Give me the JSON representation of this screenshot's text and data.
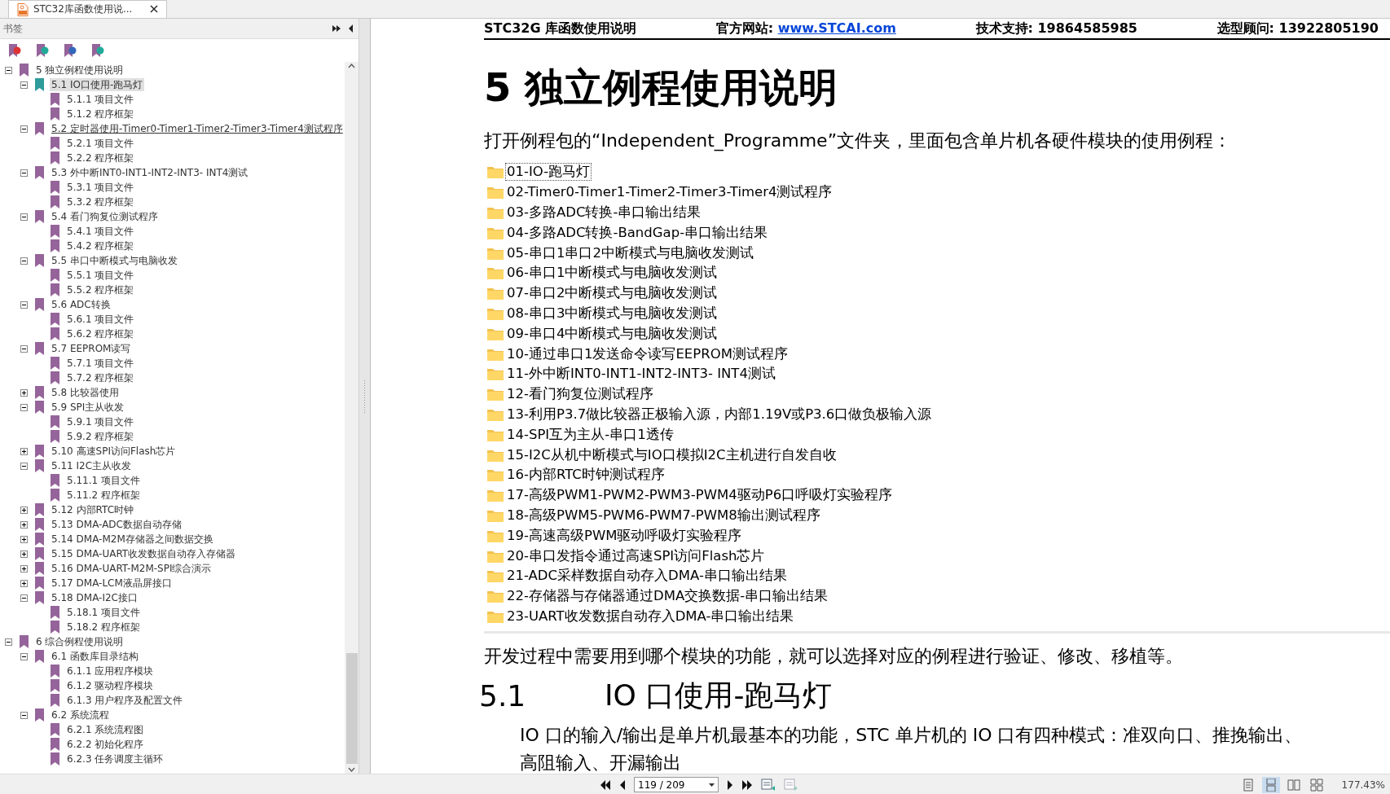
{
  "tab": {
    "title": "STC32库函数使用说..."
  },
  "bookmarks_panel": {
    "title": "书签",
    "tree": [
      {
        "label": "5 独立例程使用说明",
        "expanded": true,
        "selected": false,
        "hovered": false,
        "children": [
          {
            "label": "5.1 IO口使用-跑马灯",
            "expanded": true,
            "selected": true,
            "hovered": false,
            "children": [
              {
                "label": "5.1.1 项目文件",
                "selected": false,
                "hovered": false
              },
              {
                "label": "5.1.2 程序框架",
                "selected": false,
                "hovered": false
              }
            ]
          },
          {
            "label": "5.2 定时器使用-Timer0-Timer1-Timer2-Timer3-Timer4测试程序",
            "expanded": true,
            "selected": false,
            "hovered": true,
            "children": [
              {
                "label": "5.2.1 项目文件",
                "selected": false,
                "hovered": false
              },
              {
                "label": "5.2.2 程序框架",
                "selected": false,
                "hovered": false
              }
            ]
          },
          {
            "label": "5.3 外中断INT0-INT1-INT2-INT3- INT4测试",
            "expanded": true,
            "selected": false,
            "hovered": false,
            "children": [
              {
                "label": "5.3.1 项目文件",
                "selected": false,
                "hovered": false
              },
              {
                "label": "5.3.2 程序框架",
                "selected": false,
                "hovered": false
              }
            ]
          },
          {
            "label": "5.4 看门狗复位测试程序",
            "expanded": true,
            "selected": false,
            "hovered": false,
            "children": [
              {
                "label": "5.4.1 项目文件",
                "selected": false,
                "hovered": false
              },
              {
                "label": "5.4.2 程序框架",
                "selected": false,
                "hovered": false
              }
            ]
          },
          {
            "label": "5.5 串口中断模式与电脑收发",
            "expanded": true,
            "selected": false,
            "hovered": false,
            "children": [
              {
                "label": "5.5.1 项目文件",
                "selected": false,
                "hovered": false
              },
              {
                "label": "5.5.2 程序框架",
                "selected": false,
                "hovered": false
              }
            ]
          },
          {
            "label": "5.6 ADC转换",
            "expanded": true,
            "selected": false,
            "hovered": false,
            "children": [
              {
                "label": "5.6.1 项目文件",
                "selected": false,
                "hovered": false
              },
              {
                "label": "5.6.2 程序框架",
                "selected": false,
                "hovered": false
              }
            ]
          },
          {
            "label": "5.7 EEPROM读写",
            "expanded": true,
            "selected": false,
            "hovered": false,
            "children": [
              {
                "label": "5.7.1 项目文件",
                "selected": false,
                "hovered": false
              },
              {
                "label": "5.7.2 程序框架",
                "selected": false,
                "hovered": false
              }
            ]
          },
          {
            "label": "5.8 比较器使用",
            "expanded": false,
            "selected": false,
            "hovered": false
          },
          {
            "label": "5.9 SPI主从收发",
            "expanded": true,
            "selected": false,
            "hovered": false,
            "children": [
              {
                "label": "5.9.1 项目文件",
                "selected": false,
                "hovered": false
              },
              {
                "label": "5.9.2 程序框架",
                "selected": false,
                "hovered": false
              }
            ]
          },
          {
            "label": "5.10 高速SPI访问Flash芯片",
            "expanded": false,
            "selected": false,
            "hovered": false
          },
          {
            "label": "5.11 I2C主从收发",
            "expanded": true,
            "selected": false,
            "hovered": false,
            "children": [
              {
                "label": "5.11.1 项目文件",
                "selected": false,
                "hovered": false
              },
              {
                "label": "5.11.2 程序框架",
                "selected": false,
                "hovered": false
              }
            ]
          },
          {
            "label": "5.12 内部RTC时钟",
            "expanded": false,
            "selected": false,
            "hovered": false
          },
          {
            "label": "5.13 DMA-ADC数据自动存储",
            "expanded": false,
            "selected": false,
            "hovered": false
          },
          {
            "label": "5.14 DMA-M2M存储器之间数据交换",
            "expanded": false,
            "selected": false,
            "hovered": false
          },
          {
            "label": "5.15 DMA-UART收发数据自动存入存储器",
            "expanded": false,
            "selected": false,
            "hovered": false
          },
          {
            "label": "5.16 DMA-UART-M2M-SPI综合演示",
            "expanded": false,
            "selected": false,
            "hovered": false
          },
          {
            "label": "5.17 DMA-LCM液晶屏接口",
            "expanded": false,
            "selected": false,
            "hovered": false
          },
          {
            "label": "5.18 DMA-I2C接口",
            "expanded": true,
            "selected": false,
            "hovered": false,
            "children": [
              {
                "label": "5.18.1 项目文件",
                "selected": false,
                "hovered": false
              },
              {
                "label": "5.18.2 程序框架",
                "selected": false,
                "hovered": false
              }
            ]
          }
        ]
      },
      {
        "label": "6 综合例程使用说明",
        "expanded": true,
        "selected": false,
        "hovered": false,
        "children": [
          {
            "label": "6.1 函数库目录结构",
            "expanded": true,
            "selected": false,
            "hovered": false,
            "children": [
              {
                "label": "6.1.1 应用程序模块",
                "selected": false,
                "hovered": false
              },
              {
                "label": "6.1.2 驱动程序模块",
                "selected": false,
                "hovered": false
              },
              {
                "label": "6.1.3 用户程序及配置文件",
                "selected": false,
                "hovered": false
              }
            ]
          },
          {
            "label": "6.2 系统流程",
            "expanded": true,
            "selected": false,
            "hovered": false,
            "children": [
              {
                "label": "6.2.1 系统流程图",
                "selected": false,
                "hovered": false
              },
              {
                "label": "6.2.2 初始化程序",
                "selected": false,
                "hovered": false
              },
              {
                "label": "6.2.3 任务调度主循环",
                "selected": false,
                "hovered": false
              }
            ]
          }
        ]
      }
    ]
  },
  "document": {
    "header": {
      "title": "STC32G 库函数使用说明",
      "website_label": "官方网站:",
      "website": "www.STCAI.com",
      "support": "技术支持: 19864585985",
      "advisor": "选型顾问: 13922805190"
    },
    "heading": "5 独立例程使用说明",
    "intro": "打开例程包的“Independent_Programme”文件夹，里面包含单片机各硬件模块的使用例程：",
    "folders": [
      {
        "name": "01-IO-跑马灯",
        "selected": true
      },
      {
        "name": "02-Timer0-Timer1-Timer2-Timer3-Timer4测试程序",
        "selected": false
      },
      {
        "name": "03-多路ADC转换-串口输出结果",
        "selected": false
      },
      {
        "name": "04-多路ADC转换-BandGap-串口输出结果",
        "selected": false
      },
      {
        "name": "05-串口1串口2中断模式与电脑收发测试",
        "selected": false
      },
      {
        "name": "06-串口1中断模式与电脑收发测试",
        "selected": false
      },
      {
        "name": "07-串口2中断模式与电脑收发测试",
        "selected": false
      },
      {
        "name": "08-串口3中断模式与电脑收发测试",
        "selected": false
      },
      {
        "name": "09-串口4中断模式与电脑收发测试",
        "selected": false
      },
      {
        "name": "10-通过串口1发送命令读写EEPROM测试程序",
        "selected": false
      },
      {
        "name": "11-外中断INT0-INT1-INT2-INT3- INT4测试",
        "selected": false
      },
      {
        "name": "12-看门狗复位测试程序",
        "selected": false
      },
      {
        "name": "13-利用P3.7做比较器正极输入源，内部1.19V或P3.6口做负极输入源",
        "selected": false
      },
      {
        "name": "14-SPI互为主从-串口1透传",
        "selected": false
      },
      {
        "name": "15-I2C从机中断模式与IO口模拟I2C主机进行自发自收",
        "selected": false
      },
      {
        "name": "16-内部RTC时钟测试程序",
        "selected": false
      },
      {
        "name": "17-高级PWM1-PWM2-PWM3-PWM4驱动P6口呼吸灯实验程序",
        "selected": false
      },
      {
        "name": "18-高级PWM5-PWM6-PWM7-PWM8输出测试程序",
        "selected": false
      },
      {
        "name": "19-高速高级PWM驱动呼吸灯实验程序",
        "selected": false
      },
      {
        "name": "20-串口发指令通过高速SPI访问Flash芯片",
        "selected": false
      },
      {
        "name": "21-ADC采样数据自动存入DMA-串口输出结果",
        "selected": false
      },
      {
        "name": "22-存储器与存储器通过DMA交换数据-串口输出结果",
        "selected": false
      },
      {
        "name": "23-UART收发数据自动存入DMA-串口输出结果",
        "selected": false
      }
    ],
    "paragraph": "开发过程中需要用到哪个模块的功能，就可以选择对应的例程进行验证、修改、移植等。",
    "section": {
      "number": "5.1",
      "title": "IO 口使用-跑马灯"
    },
    "body_lines": [
      "IO 口的输入/输出是单片机最基本的功能，STC 单片机的 IO 口有四种模式：准双向口、推挽输出、",
      "高阻输入、开漏输出"
    ]
  },
  "status_bar": {
    "page": "119 / 209",
    "zoom": "177.43%",
    "view_modes": [
      {
        "kind": "single",
        "selected": false
      },
      {
        "kind": "continuous",
        "selected": true
      },
      {
        "kind": "facing",
        "selected": false
      },
      {
        "kind": "continuous-facing",
        "selected": false
      }
    ]
  }
}
